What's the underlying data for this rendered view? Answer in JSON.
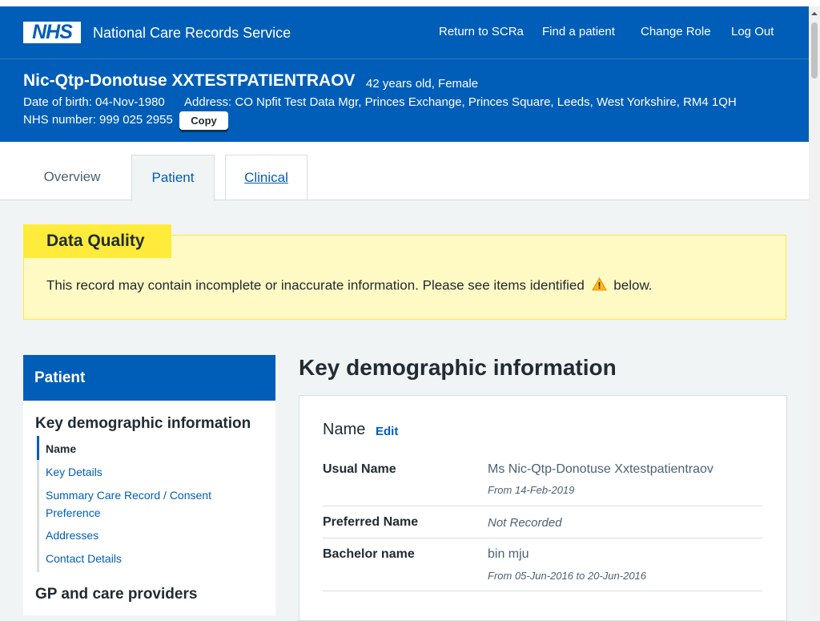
{
  "header": {
    "logo_text": "NHS",
    "service_name": "National Care Records Service",
    "nav": [
      "Return to SCRa",
      "Find a patient",
      "Change Role",
      "Log Out"
    ]
  },
  "patient_banner": {
    "name": "Nic-Qtp-Donotuse XXTESTPATIENTRAOV",
    "age_gender": "42 years old, Female",
    "dob": "Date of birth: 04-Nov-1980",
    "address": "Address: CO Npfit Test Data Mgr, Princes Exchange, Princes Square, Leeds, West Yorkshire, RM4 1QH",
    "nhs_number": "NHS number: 999 025 2955",
    "copy_label": "Copy"
  },
  "tabs": [
    {
      "label": "Overview"
    },
    {
      "label": "Patient"
    },
    {
      "label": "Clinical"
    }
  ],
  "data_quality": {
    "heading": "Data Quality",
    "text_before": "This record may contain incomplete or inaccurate information. Please see items identified",
    "text_after": "below.",
    "icon": "warning-icon"
  },
  "sidebar": {
    "heading": "Patient",
    "section1": "Key demographic information",
    "items": [
      "Name",
      "Key Details",
      "Summary Care Record / Consent Preference",
      "Addresses",
      "Contact Details"
    ],
    "section2": "GP and care providers"
  },
  "main": {
    "title": "Key demographic information",
    "card_title": "Name",
    "edit_label": "Edit",
    "rows": [
      {
        "label": "Usual Name",
        "value": "Ms Nic-Qtp-Donotuse Xxtestpatientraov",
        "sub": "From 14-Feb-2019"
      },
      {
        "label": "Preferred Name",
        "value": "Not Recorded",
        "sub": ""
      },
      {
        "label": "Bachelor name",
        "value": "bin mju",
        "sub": "From 05-Jun-2016 to 20-Jun-2016"
      }
    ]
  },
  "colors": {
    "nhs_blue": "#005eb8",
    "warning_yellow": "#ffeb3b",
    "warning_bg": "#fff9c4",
    "page_bg": "#f0f4f5"
  }
}
